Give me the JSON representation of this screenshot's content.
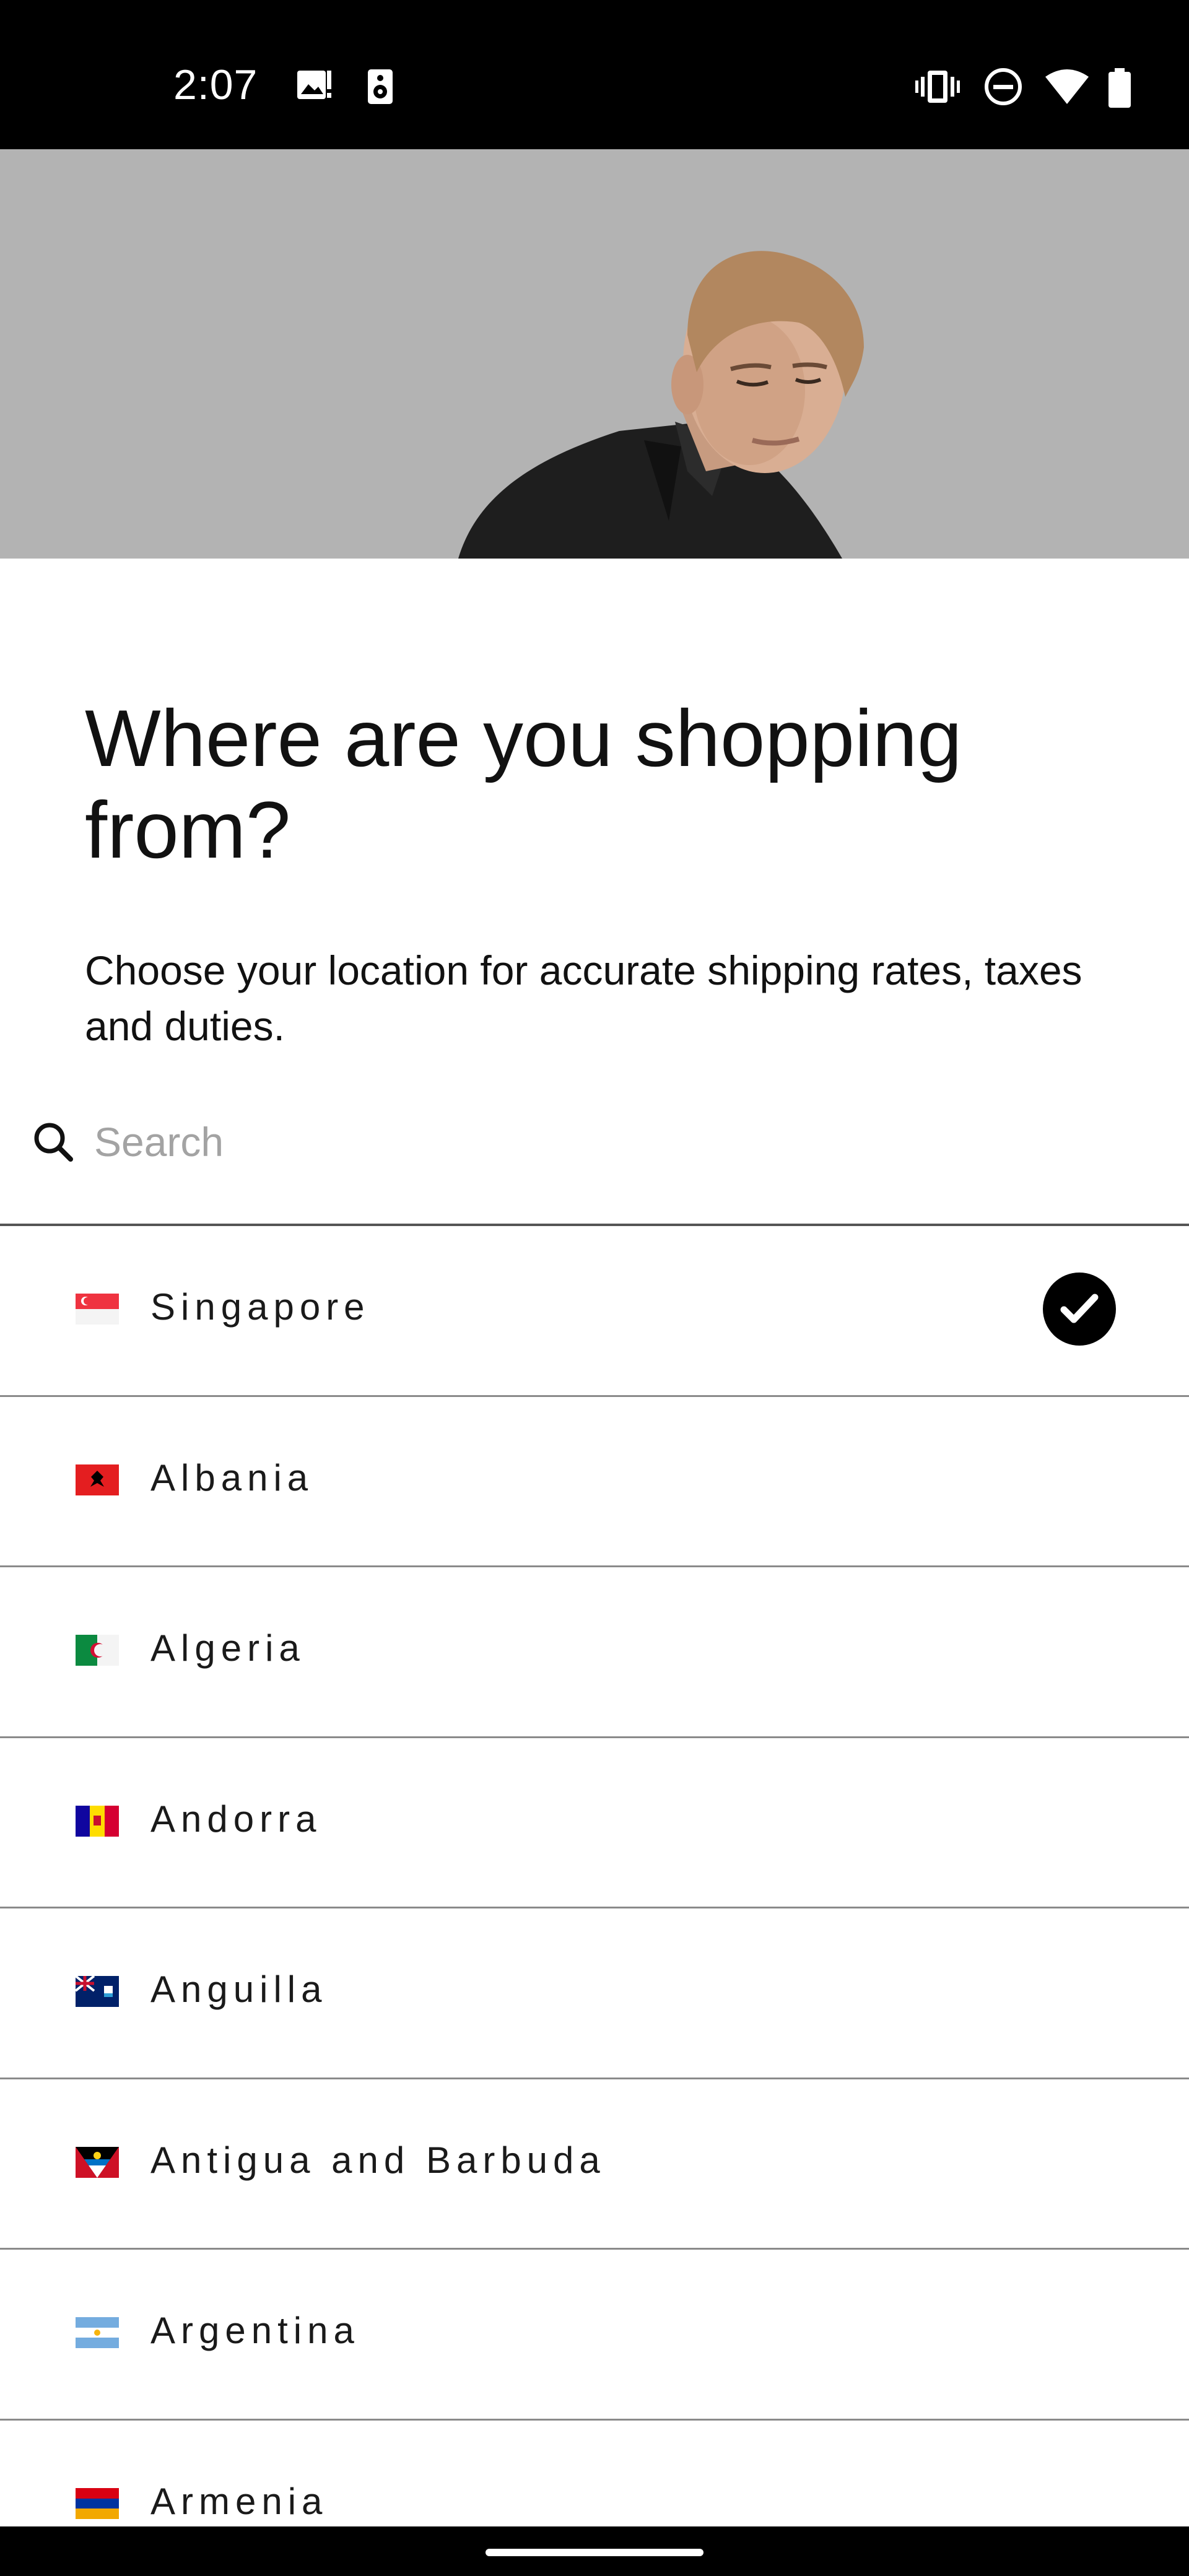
{
  "status_bar": {
    "time": "2:07",
    "icons": [
      "image-notification-icon",
      "speaker-icon",
      "vibrate-icon",
      "do-not-disturb-icon",
      "wifi-icon",
      "battery-icon"
    ]
  },
  "hero": {
    "image": "model-portrait-photo"
  },
  "heading": {
    "title": "Where are you shopping from?",
    "subtitle": "Choose your location for accurate shipping rates, taxes and duties."
  },
  "search": {
    "placeholder": "Search",
    "value": ""
  },
  "countries": [
    {
      "name": "Singapore",
      "flag": "singapore-flag",
      "selected": true
    },
    {
      "name": "Albania",
      "flag": "albania-flag",
      "selected": false
    },
    {
      "name": "Algeria",
      "flag": "algeria-flag",
      "selected": false
    },
    {
      "name": "Andorra",
      "flag": "andorra-flag",
      "selected": false
    },
    {
      "name": "Anguilla",
      "flag": "anguilla-flag",
      "selected": false
    },
    {
      "name": "Antigua and Barbuda",
      "flag": "antigua-and-barbuda-flag",
      "selected": false
    },
    {
      "name": "Argentina",
      "flag": "argentina-flag",
      "selected": false
    },
    {
      "name": "Armenia",
      "flag": "armenia-flag",
      "selected": false
    }
  ],
  "colors": {
    "accent": "#000000",
    "divider": "#8a8a8a",
    "hero_bg": "#b3b3b3"
  }
}
